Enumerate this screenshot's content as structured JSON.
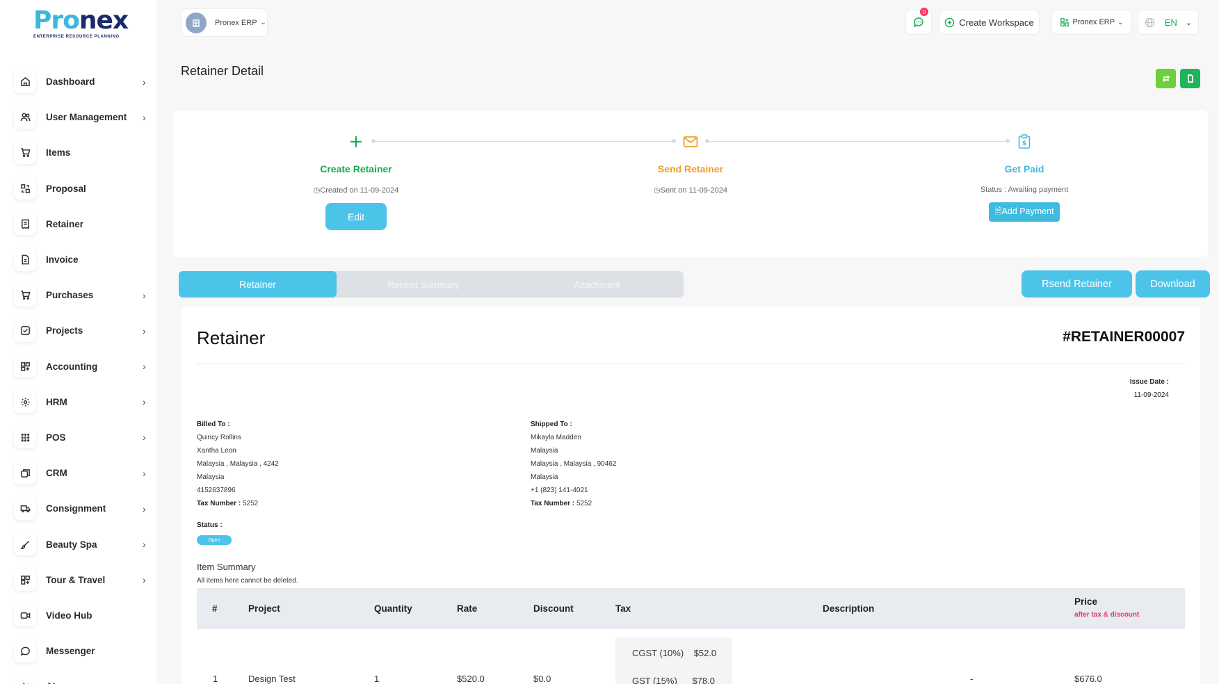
{
  "logo": {
    "main": "Pronex",
    "tagline": "ENTERPRISE RESOURCE PLANNING"
  },
  "sidebar": {
    "items": [
      {
        "label": "Dashboard",
        "icon": "home-icon",
        "chevron": true
      },
      {
        "label": "User Management",
        "icon": "users-icon",
        "chevron": true
      },
      {
        "label": "Items",
        "icon": "cart-icon",
        "chevron": false
      },
      {
        "label": "Proposal",
        "icon": "swap-icon",
        "chevron": false
      },
      {
        "label": "Retainer",
        "icon": "receipt-icon",
        "chevron": false
      },
      {
        "label": "Invoice",
        "icon": "file-icon",
        "chevron": false
      },
      {
        "label": "Purchases",
        "icon": "cart-icon",
        "chevron": true
      },
      {
        "label": "Projects",
        "icon": "check-square-icon",
        "chevron": true
      },
      {
        "label": "Accounting",
        "icon": "grid-plus-icon",
        "chevron": true
      },
      {
        "label": "HRM",
        "icon": "hrm-icon",
        "chevron": true
      },
      {
        "label": "POS",
        "icon": "dots-grid-icon",
        "chevron": true
      },
      {
        "label": "CRM",
        "icon": "layers-icon",
        "chevron": true
      },
      {
        "label": "Consignment",
        "icon": "truck-icon",
        "chevron": true
      },
      {
        "label": "Beauty Spa",
        "icon": "brush-icon",
        "chevron": true
      },
      {
        "label": "Tour & Travel",
        "icon": "grid-plus-icon",
        "chevron": true
      },
      {
        "label": "Video Hub",
        "icon": "video-icon",
        "chevron": false
      },
      {
        "label": "Messenger",
        "icon": "chat-icon",
        "chevron": false
      },
      {
        "label": "AI",
        "icon": "ai-icon",
        "chevron": true
      }
    ]
  },
  "topbar": {
    "workspace_label": "Pronex ERP",
    "message_count": "0",
    "create_workspace": "Create Workspace",
    "erp_label": "Pronex ERP",
    "language": "EN"
  },
  "page": {
    "title": "Retainer Detail"
  },
  "progress": {
    "steps": [
      {
        "title": "Create Retainer",
        "sub": "Created on 11-09-2024",
        "color": "#1aa952",
        "action": "Edit"
      },
      {
        "title": "Send Retainer",
        "sub": "Sent on 11-09-2024",
        "color": "#f39c2b"
      },
      {
        "title": "Get Paid",
        "sub": "Status : Awaiting payment",
        "color": "#3fbbe0",
        "action": "Add Payment"
      }
    ]
  },
  "tabs": [
    "Retainer",
    "Receipt Summary",
    "Attachment"
  ],
  "actions": {
    "resend": "Rsend Retainer",
    "download": "Download"
  },
  "document": {
    "title": "Retainer",
    "number": "#RETAINER00007",
    "issue_date_label": "Issue Date :",
    "issue_date": "11-09-2024",
    "billed": {
      "label": "Billed To :",
      "lines": [
        "Quincy Rollins",
        "Xantha Leon",
        "Malaysia , Malaysia , 4242",
        "Malaysia",
        "4152637896"
      ],
      "tax_label": "Tax Number :",
      "tax": "5252"
    },
    "shipped": {
      "label": "Shipped To :",
      "lines": [
        "Mikayla Madden",
        "Malaysia",
        "Malaysia , Malaysia , 90462",
        "Malaysia",
        "+1 (823) 141-4021"
      ],
      "tax_label": "Tax Number :",
      "tax": "5252"
    },
    "status_label": "Status :",
    "status": "Open",
    "summary_title": "Item Summary",
    "summary_sub": "All items here cannot be deleted.",
    "table": {
      "headers": [
        "#",
        "Project",
        "Quantity",
        "Rate",
        "Discount",
        "Tax",
        "Description",
        "Price"
      ],
      "price_note": "after tax & discount",
      "rows": [
        {
          "num": "1",
          "project": "Design Test",
          "quantity": "1",
          "rate": "$520.0",
          "discount": "$0.0",
          "taxes": [
            {
              "name": "CGST (10%)",
              "amount": "$52.0"
            },
            {
              "name": "GST (15%)",
              "amount": "$78.0"
            }
          ],
          "description": "-",
          "price": "$676.0"
        }
      ]
    }
  }
}
